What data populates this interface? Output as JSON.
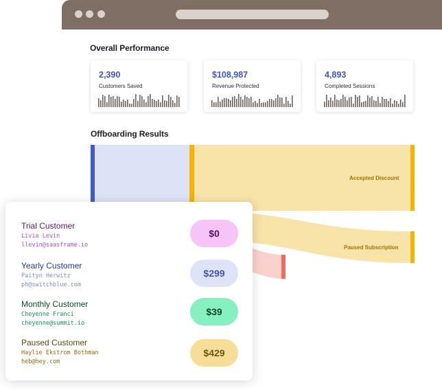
{
  "overall_performance": {
    "title": "Overall Performance",
    "cards": [
      {
        "value": "2,390",
        "label": "Customers Saved"
      },
      {
        "value": "$108,987",
        "label": "Revenue Protected"
      },
      {
        "value": "4,893",
        "label": "Completed Sessions"
      }
    ]
  },
  "offboarding": {
    "title": "Offboarding Results",
    "flows": [
      {
        "label": "Accepted Discount"
      },
      {
        "label": "Paused Subscription"
      }
    ]
  },
  "customers": [
    {
      "type": "Trial Customer",
      "name": "Livia Levin",
      "email": "llevin@saasframe.io",
      "amount": "$0",
      "type_color": "#5d1769",
      "text_color": "#b24ad1",
      "pill_bg": "#f6c4f6",
      "pill_text": "#52145e"
    },
    {
      "type": "Yearly Customer",
      "name": "Paityn Herwitz",
      "email": "ph@switchblue.com",
      "amount": "$299",
      "type_color": "#24388f",
      "text_color": "#7f8fb3",
      "pill_bg": "#dfe3f7",
      "pill_text": "#4456b2"
    },
    {
      "type": "Monthly Customer",
      "name": "Cheyenne Franci",
      "email": "cheyenne@summit.io",
      "amount": "$39",
      "type_color": "#0e4d2c",
      "text_color": "#138f55",
      "pill_bg": "#86f0c1",
      "pill_text": "#0c4a2c"
    },
    {
      "type": "Paused Customer",
      "name": "Haylie Ekstrom Bothman",
      "email": "heb@hey.com",
      "amount": "$429",
      "type_color": "#5f4a0b",
      "text_color": "#8c6d10",
      "pill_bg": "#f7de97",
      "pill_text": "#6f5510"
    }
  ]
}
